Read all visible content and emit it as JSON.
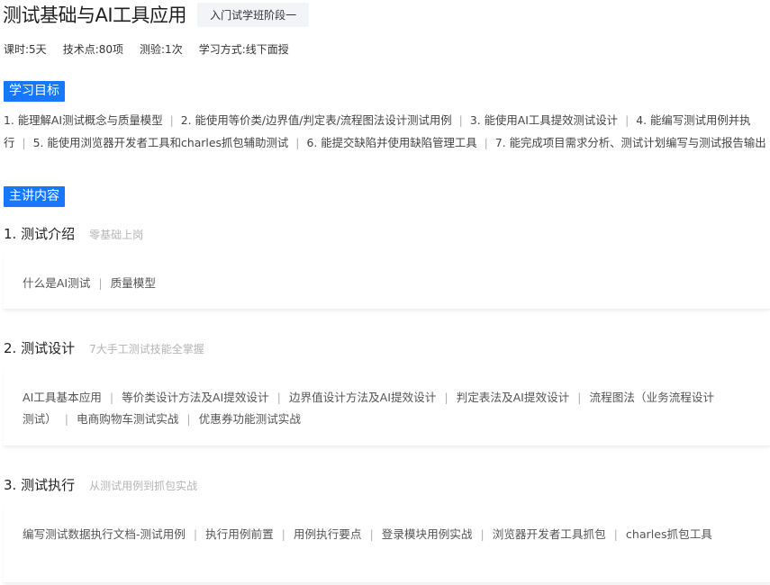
{
  "course": {
    "title": "测试基础与AI工具应用",
    "stage": "入门试学班阶段一"
  },
  "meta": [
    "课时:5天",
    "技术点:80项",
    "测验:1次",
    "学习方式:线下面授"
  ],
  "goals_label": "学习目标",
  "goals": [
    "1. 能理解AI测试概念与质量模型",
    "2. 能使用等价类/边界值/判定表/流程图法设计测试用例",
    "3. 能使用AI工具提效测试设计",
    "4. 能编写测试用例并执行",
    "5. 能使用浏览器开发者工具和charles抓包辅助测试",
    "6. 能提交缺陷并使用缺陷管理工具",
    "7. 能完成项目需求分析、测试计划编写与测试报告输出"
  ],
  "content_label": "主讲内容",
  "separator": "|",
  "modules": [
    {
      "name": "1. 测试介绍",
      "subtitle": "零基础上岗",
      "topics": [
        "什么是AI测试",
        "质量模型"
      ]
    },
    {
      "name": "2. 测试设计",
      "subtitle": "7大手工测试技能全掌握",
      "topics": [
        "AI工具基本应用",
        "等价类设计方法及AI提效设计",
        "边界值设计方法及AI提效设计",
        "判定表法及AI提效设计",
        "流程图法（业务流程设计测试）",
        "电商购物车测试实战",
        "优惠券功能测试实战"
      ]
    },
    {
      "name": "3. 测试执行",
      "subtitle": "从测试用例到抓包实战",
      "topics": [
        "编写测试数据执行文档-测试用例",
        "执行用例前置",
        "用例执行要点",
        "登录模块用例实战",
        "浏览器开发者工具抓包",
        "charles抓包工具"
      ]
    }
  ]
}
